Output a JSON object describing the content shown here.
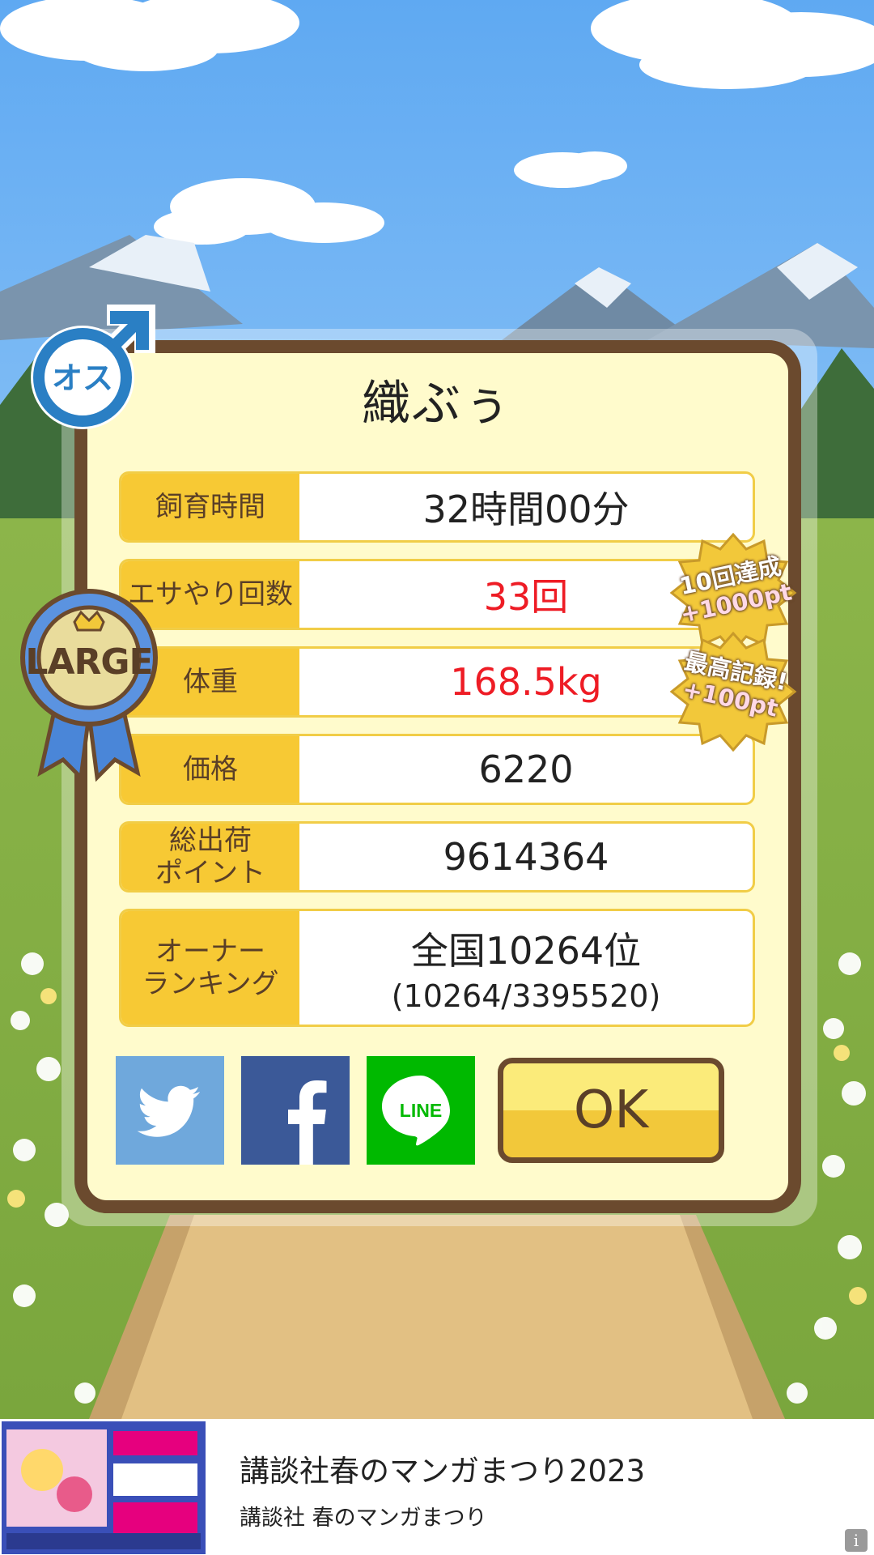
{
  "pet": {
    "name": "織ぶぅ",
    "gender_badge": "オス",
    "size_badge": "LARGE"
  },
  "stats": [
    {
      "label": "飼育時間",
      "value": "32時間00分"
    },
    {
      "label": "エサやり回数",
      "value": "33回"
    },
    {
      "label": "体重",
      "value": "168.5kg"
    },
    {
      "label": "価格",
      "value": "6220"
    },
    {
      "label": "総出荷\nポイント",
      "value": "9614364"
    },
    {
      "label": "オーナー\nランキング",
      "value": "全国10264位",
      "sub": "(10264/3395520)"
    }
  ],
  "achievements": [
    {
      "line1": "10回達成",
      "line2": "+1000pt"
    },
    {
      "line1": "最高記録!",
      "line2": "+100pt"
    }
  ],
  "share": {
    "twitter_icon": "twitter-icon",
    "facebook_icon": "facebook-icon",
    "line_label": "LINE"
  },
  "ok_label": "OK",
  "ad": {
    "title": "講談社春のマンガまつり2023",
    "subtitle": "講談社 春のマンガまつり"
  },
  "colors": {
    "label_bg": "#f7c934",
    "frame": "#6b4a2e",
    "panel_bg": "#fffbcc",
    "highlight_red": "#ee1c25",
    "twitter": "#6fa8dc",
    "facebook": "#3b5998",
    "line": "#00b900"
  }
}
